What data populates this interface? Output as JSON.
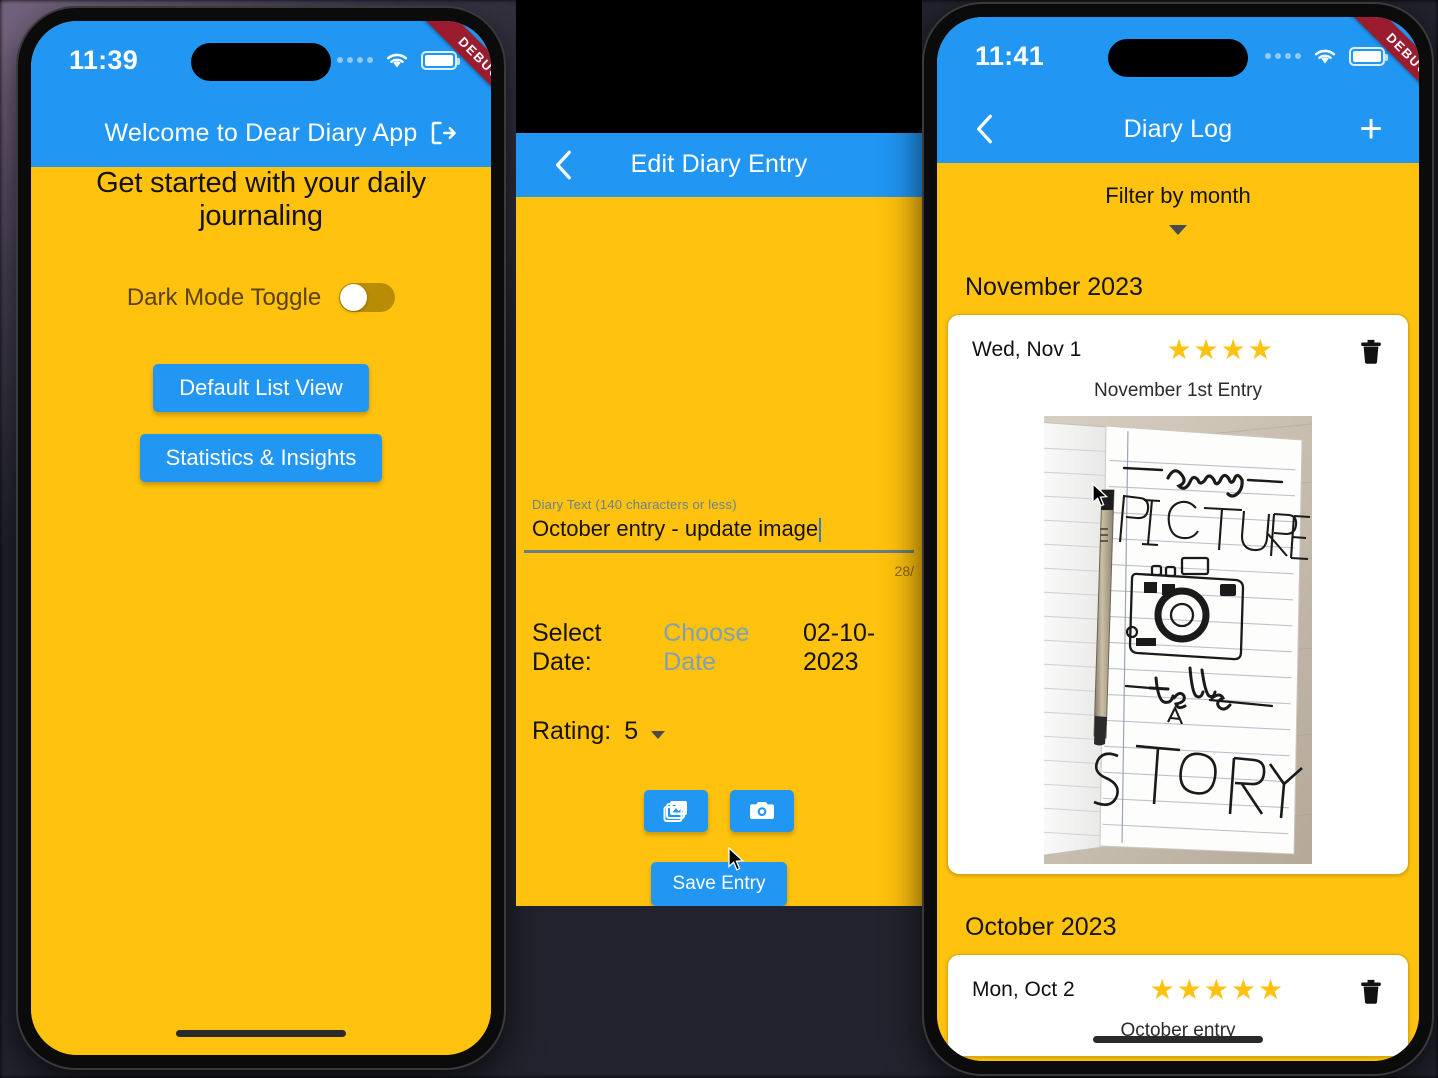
{
  "colors": {
    "app_blue": "#2196F3",
    "app_yellow": "#FFC20E",
    "star_gold": "#FFC20E",
    "debug_ribbon": "#9b1c2e"
  },
  "screens": [
    {
      "id": "home",
      "status_bar": {
        "time": "11:39",
        "debug_label": "DEBUG"
      },
      "appbar": {
        "title": "Welcome to Dear Diary App",
        "logout_icon": "logout-icon"
      },
      "headline": "Get started with your daily journaling",
      "toggle": {
        "label": "Dark Mode Toggle",
        "state": "off"
      },
      "buttons": [
        {
          "label": "Default List View"
        },
        {
          "label": "Statistics & Insights"
        }
      ]
    },
    {
      "id": "edit_entry",
      "appbar": {
        "title": "Edit Diary Entry",
        "back_icon": "chevron-left-icon"
      },
      "diary_text": {
        "label": "Diary Text (140 characters or less)",
        "value": "October entry - update image",
        "counter": "28/"
      },
      "date": {
        "label": "Select Date:",
        "button": "Choose Date",
        "value": "02-10-2023"
      },
      "rating": {
        "label": "Rating:",
        "value": "5"
      },
      "media_buttons": [
        {
          "icon": "photo-library-icon"
        },
        {
          "icon": "camera-icon"
        }
      ],
      "save_button": "Save Entry"
    },
    {
      "id": "diary_log",
      "status_bar": {
        "time": "11:41",
        "debug_label": "DEBUG"
      },
      "appbar": {
        "title": "Diary Log",
        "back_icon": "chevron-left-icon",
        "add_icon": "plus-icon"
      },
      "filter": {
        "title": "Filter by month",
        "selected": "",
        "chevron": "chevron-down-icon"
      },
      "sections": [
        {
          "month": "November 2023",
          "entries": [
            {
              "date": "Wed, Nov 1",
              "rating": 4,
              "caption": "November 1st Entry",
              "has_photo": true,
              "photo_alt": "lined notebook page with hand-lettered text every PICTURE tells A STORY and a drawn camera, black pen resting on left page",
              "delete_icon": "trash-icon"
            }
          ]
        },
        {
          "month": "October 2023",
          "entries": [
            {
              "date": "Mon, Oct 2",
              "rating": 5,
              "caption": "October entry",
              "has_photo": false,
              "delete_icon": "trash-icon"
            }
          ]
        }
      ]
    }
  ]
}
